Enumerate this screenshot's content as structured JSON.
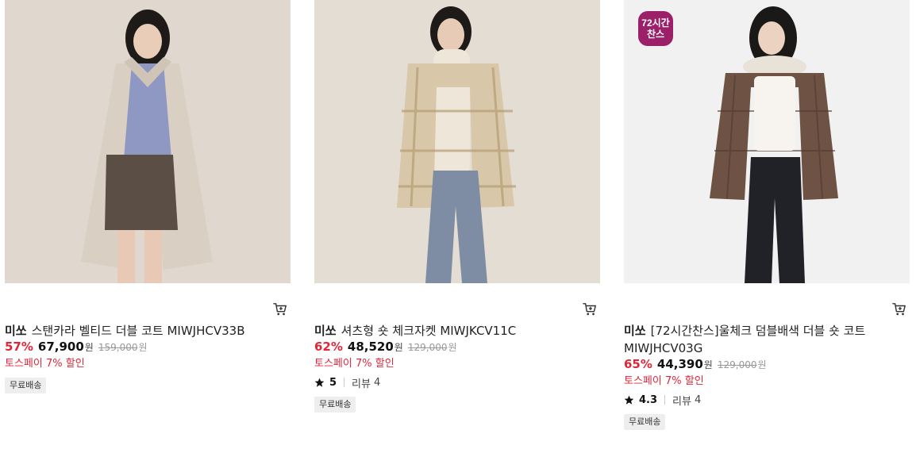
{
  "products": [
    {
      "brand": "미쏘",
      "name": "스탠카라 벨티드 더블 코트 MIWJHCV33B",
      "discount": "57%",
      "price": "67,900",
      "currency": "원",
      "original_price": "159,000",
      "promo": "토스페이 7% 할인",
      "tag": "무료배송"
    },
    {
      "brand": "미쏘",
      "name": "셔츠형 숏 체크자켓 MIWJKCV11C",
      "discount": "62%",
      "price": "48,520",
      "currency": "원",
      "original_price": "129,000",
      "promo": "토스페이 7% 할인",
      "rating": "5",
      "review_label": "리뷰",
      "review_count": "4",
      "tag": "무료배송"
    },
    {
      "badge_line1": "72시간",
      "badge_line2": "찬스",
      "brand": "미쏘",
      "name": "[72시간찬스]울체크 덤블배색 더블 숏 코트 MIWJHCV03G",
      "discount": "65%",
      "price": "44,390",
      "currency": "원",
      "original_price": "129,000",
      "promo": "토스페이 7% 할인",
      "rating": "4.3",
      "review_label": "리뷰",
      "review_count": "4",
      "tag": "무료배송"
    }
  ],
  "colors": {
    "discount": "#e2263a",
    "badge": "#9c1f6a",
    "tag_bg": "#eeeeee"
  },
  "icons": {
    "cart": "cart-icon",
    "star": "star-icon"
  }
}
